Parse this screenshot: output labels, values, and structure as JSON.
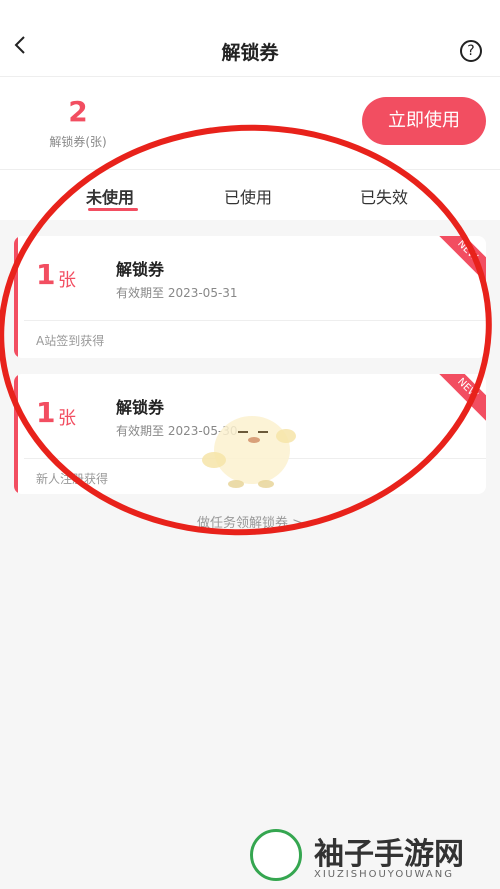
{
  "header": {
    "title": "解锁券",
    "back_icon": "chevron-left-icon",
    "help_icon": "question-circle-icon"
  },
  "summary": {
    "count": "2",
    "count_label": "解锁券(张)",
    "use_button": "立即使用"
  },
  "tabs": [
    {
      "label": "未使用",
      "active": true
    },
    {
      "label": "已使用",
      "active": false
    },
    {
      "label": "已失效",
      "active": false
    }
  ],
  "coupons": [
    {
      "count": "1",
      "unit": "张",
      "name": "解锁券",
      "expire": "有效期至 2023-05-31",
      "source": "A站签到获得",
      "badge": "NEW"
    },
    {
      "count": "1",
      "unit": "张",
      "name": "解锁券",
      "expire": "有效期至 2023-05-30",
      "source": "新人注册获得",
      "badge": "NEW"
    }
  ],
  "task_link": "做任务领解锁券 >",
  "watermark": {
    "text": "袖子手游网",
    "sub": "XIUZISHOUYOUWANG"
  },
  "colors": {
    "accent": "#f24e61",
    "annotation": "#e8221b"
  }
}
